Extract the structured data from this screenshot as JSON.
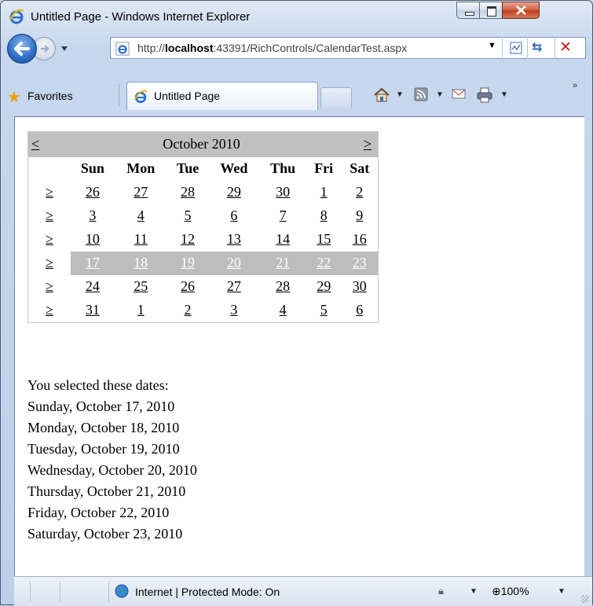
{
  "window": {
    "title": "Untitled Page - Windows Internet Explorer"
  },
  "navbar": {
    "address_prefix": "http://",
    "address_host": "localhost",
    "address_rest": ":43391/RichControls/CalendarTest.aspx"
  },
  "favorites_bar": {
    "favorites_label": "Favorites",
    "tab_label": "Untitled Page"
  },
  "calendar": {
    "month_title": "October 2010",
    "prev_label": "<",
    "next_label": ">",
    "selector_label": "≥",
    "day_headers": [
      "Sun",
      "Mon",
      "Tue",
      "Wed",
      "Thu",
      "Fri",
      "Sat"
    ],
    "weeks": [
      [
        "26",
        "27",
        "28",
        "29",
        "30",
        "1",
        "2"
      ],
      [
        "3",
        "4",
        "5",
        "6",
        "7",
        "8",
        "9"
      ],
      [
        "10",
        "11",
        "12",
        "13",
        "14",
        "15",
        "16"
      ],
      [
        "17",
        "18",
        "19",
        "20",
        "21",
        "22",
        "23"
      ],
      [
        "24",
        "25",
        "26",
        "27",
        "28",
        "29",
        "30"
      ],
      [
        "31",
        "1",
        "2",
        "3",
        "4",
        "5",
        "6"
      ]
    ],
    "selected_week_index": 3
  },
  "selection": {
    "heading": "You selected these dates:",
    "dates": [
      "Sunday, October 17, 2010",
      "Monday, October 18, 2010",
      "Tuesday, October 19, 2010",
      "Wednesday, October 20, 2010",
      "Thursday, October 21, 2010",
      "Friday, October 22, 2010",
      "Saturday, October 23, 2010"
    ]
  },
  "statusbar": {
    "zone_text": "Internet | Protected Mode: On",
    "zoom": "100%"
  }
}
